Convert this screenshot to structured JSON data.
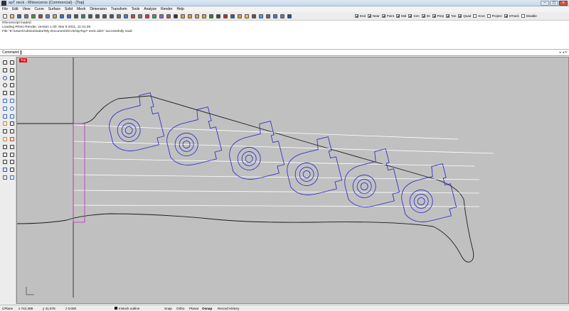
{
  "window": {
    "title": "spT neck - Rhinoceros (Commercial) - [Top]",
    "buttons": [
      "–",
      "▢",
      "✕"
    ]
  },
  "menu": [
    "File",
    "Edit",
    "View",
    "Curve",
    "Surface",
    "Solid",
    "Mesh",
    "Dimension",
    "Transform",
    "Tools",
    "Analyze",
    "Render",
    "Help"
  ],
  "toolbar": {
    "icons": [
      {
        "name": "new-icon",
        "color": "#ffffff"
      },
      {
        "name": "open-icon",
        "color": "#e8c24a"
      },
      {
        "name": "save-icon",
        "color": "#3a64b8"
      },
      {
        "name": "print-icon",
        "color": "#7a7a7a"
      },
      {
        "name": "import-icon",
        "color": "#4f8f3a"
      },
      {
        "name": "cut-icon",
        "color": "#c0392b"
      },
      {
        "name": "copy-icon",
        "color": "#5a7fc4"
      },
      {
        "name": "paste-icon",
        "color": "#c9a640"
      },
      {
        "name": "undo-icon",
        "color": "#3c6ec2"
      },
      {
        "name": "redo-icon",
        "color": "#3c6ec2"
      },
      {
        "name": "pan-icon",
        "color": "#555555"
      },
      {
        "name": "rotate-view-icon",
        "color": "#2f8a5b"
      },
      {
        "name": "zoom-dynamic-icon",
        "color": "#555555"
      },
      {
        "name": "zoom-window-icon",
        "color": "#555555"
      },
      {
        "name": "zoom-extents-icon",
        "color": "#555555"
      },
      {
        "name": "zoom-selected-icon",
        "color": "#555555"
      },
      {
        "name": "undo-view-icon",
        "color": "#6f6f6f"
      },
      {
        "name": "four-views-icon",
        "color": "#4b77be"
      },
      {
        "name": "set-cplane-icon",
        "color": "#b35b2a"
      },
      {
        "name": "wireframe-icon",
        "color": "#777777"
      },
      {
        "name": "shaded-icon",
        "color": "#d63b3b"
      },
      {
        "name": "rendered-icon",
        "color": "#3fa34d"
      },
      {
        "name": "ghosted-icon",
        "color": "#7f6bc4"
      },
      {
        "name": "xray-icon",
        "color": "#c4503b"
      },
      {
        "name": "select-all-icon",
        "color": "#333333"
      },
      {
        "name": "hide-icon",
        "color": "#d8a62a"
      },
      {
        "name": "show-icon",
        "color": "#d8a62a"
      },
      {
        "name": "lock-icon",
        "color": "#d8a62a"
      },
      {
        "name": "unlock-icon",
        "color": "#d8a62a"
      },
      {
        "name": "layer-icon",
        "color": "#2e7d32"
      },
      {
        "name": "properties-icon",
        "color": "#444444"
      },
      {
        "name": "object-snap-icon",
        "color": "#c62828"
      },
      {
        "name": "render-icon",
        "color": "#1565c0"
      },
      {
        "name": "material-icon",
        "color": "#e89a2b"
      },
      {
        "name": "light-icon",
        "color": "#f5c518"
      },
      {
        "name": "camera-icon",
        "color": "#555555"
      },
      {
        "name": "environment-icon",
        "color": "#4aa3df"
      },
      {
        "name": "options-icon",
        "color": "#666666"
      },
      {
        "name": "analyze-icon",
        "color": "#3a7bd5"
      },
      {
        "name": "distance-icon",
        "color": "#777777"
      },
      {
        "name": "help-icon",
        "color": "#1e4fa3"
      }
    ]
  },
  "osnaps": [
    {
      "label": "End",
      "checked": true
    },
    {
      "label": "Near",
      "checked": true
    },
    {
      "label": "Point",
      "checked": true
    },
    {
      "label": "Mid",
      "checked": true
    },
    {
      "label": "Cen",
      "checked": true
    },
    {
      "label": "Int",
      "checked": true
    },
    {
      "label": "Perp",
      "checked": true
    },
    {
      "label": "Tan",
      "checked": true
    },
    {
      "label": "Quad",
      "checked": true
    },
    {
      "label": "Knot",
      "checked": false
    },
    {
      "label": "Project",
      "checked": false
    },
    {
      "label": "STrack",
      "checked": true
    },
    {
      "label": "Disable",
      "checked": false
    }
  ],
  "history": [
    "RhinoScript loaded.",
    "Loading Rhino Render, version 1.00, Mar 9 2011, 11:41:28",
    "File \"E:\\Users\\Administrator\\My Documents\\CAD\\spTop7 neck.3dm\" successfully read"
  ],
  "command": {
    "label": "Command:",
    "arrows": "▸ ◂ ▾"
  },
  "viewport": {
    "label": "Top",
    "background": "#c0c0c0",
    "curve_color": "#2525c8",
    "outline_color": "#1a1a1a",
    "nut_color": "#c040c0",
    "string_color": "#ffffff"
  },
  "status": {
    "cplane": "CPlane",
    "x": "x 742.388",
    "y": "y 41.678",
    "z": "z 0.000",
    "layer": "Instock outline",
    "snap": "Snap",
    "ortho": "Ortho",
    "planar": "Planar",
    "osnap": "Osnap",
    "record": "Record History"
  }
}
